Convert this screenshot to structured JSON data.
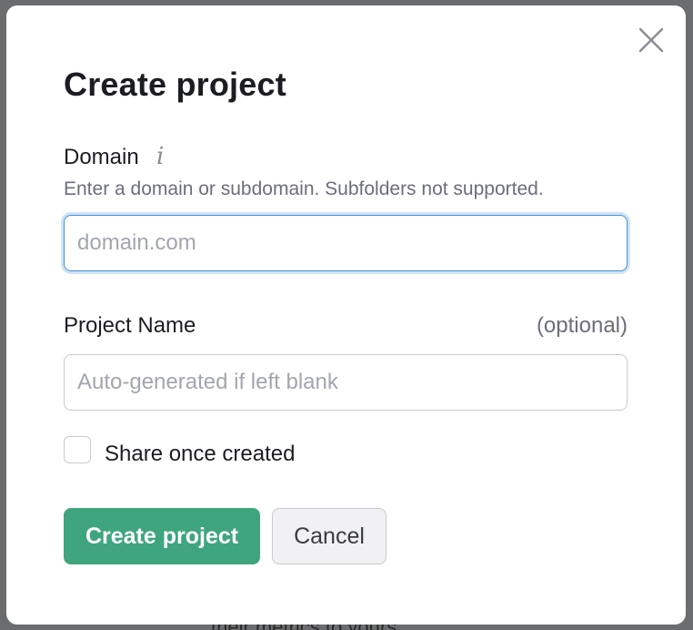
{
  "background": {
    "peek_text": "their metrics to yours"
  },
  "dialog": {
    "title": "Create project",
    "close_icon": "close-icon",
    "domain": {
      "label": "Domain",
      "info_icon": "info-icon",
      "hint": "Enter a domain or subdomain. Subfolders not supported.",
      "value": "",
      "placeholder": "domain.com"
    },
    "project_name": {
      "label": "Project Name",
      "optional": "(optional)",
      "value": "",
      "placeholder": "Auto-generated if left blank"
    },
    "share": {
      "label": "Share once created",
      "checked": false
    },
    "buttons": {
      "create_label": "Create project",
      "cancel_label": "Cancel"
    }
  },
  "colors": {
    "primary": "#3fa57f",
    "focus_border": "#4a8fd6",
    "text": "#1c1d22",
    "muted": "#6c6e79"
  }
}
